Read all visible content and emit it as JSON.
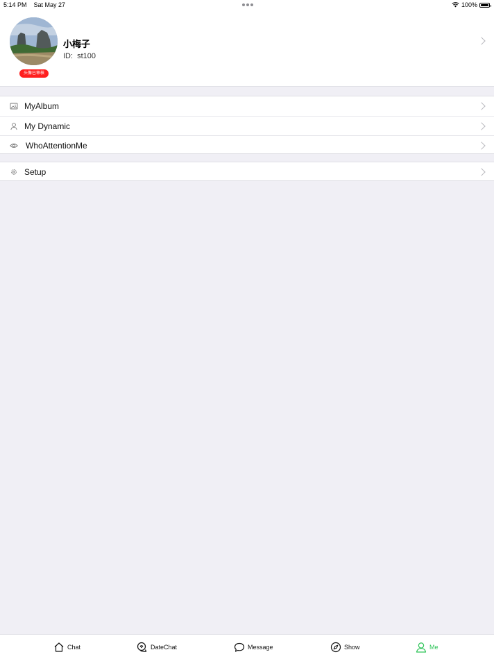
{
  "status_bar": {
    "time": "5:14 PM",
    "date": "Sat May 27",
    "battery": "100%"
  },
  "profile": {
    "name": "小梅子",
    "id_label": "ID:",
    "id_value": "st100",
    "badge": "头像已审核"
  },
  "menu": {
    "album": "MyAlbum",
    "dynamic": "My Dynamic",
    "attention": "WhoAttentionMe",
    "setup": "Setup"
  },
  "tabs": [
    {
      "label": "Chat",
      "icon": "home-icon"
    },
    {
      "label": "DateChat",
      "icon": "datechat-icon"
    },
    {
      "label": "Message",
      "icon": "message-bubble-icon"
    },
    {
      "label": "Show",
      "icon": "compass-icon"
    },
    {
      "label": "Me",
      "icon": "person-icon",
      "active": true
    }
  ],
  "colors": {
    "accent": "#2ec458",
    "badge": "#ff1f1f",
    "background": "#f0eff5"
  }
}
